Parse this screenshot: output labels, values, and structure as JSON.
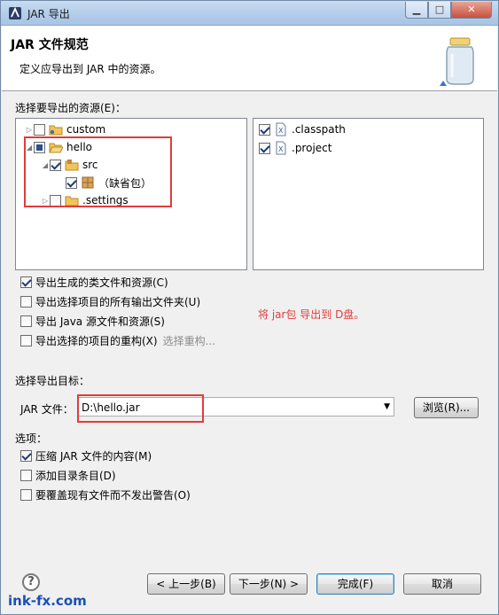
{
  "window": {
    "title": "JAR 导出"
  },
  "header": {
    "title": "JAR 文件规范",
    "description": "定义应导出到 JAR 中的资源。"
  },
  "resources": {
    "label": "选择要导出的资源(E)：",
    "tree": [
      {
        "label": "custom",
        "state": "unchecked"
      },
      {
        "label": "hello",
        "state": "partial"
      },
      {
        "label": "src",
        "state": "checked"
      },
      {
        "label": "（缺省包）",
        "state": "checked"
      },
      {
        "label": ".settings",
        "state": "unchecked"
      }
    ],
    "files": [
      {
        "label": ".classpath",
        "state": "checked"
      },
      {
        "label": ".project",
        "state": "checked"
      }
    ]
  },
  "options_top": {
    "export_classes": {
      "label": "导出生成的类文件和资源(C)",
      "checked": true
    },
    "export_output_folders": {
      "label": "导出选择项目的所有输出文件夹(U)",
      "checked": false
    },
    "export_java_source": {
      "label": "导出 Java 源文件和资源(S)",
      "checked": false
    },
    "export_refactorings": {
      "label": "导出选择的项目的重构(X)",
      "checked": false,
      "link": "选择重构..."
    }
  },
  "annotation": "将 jar包 导出到 D盘。",
  "destination": {
    "label": "选择导出目标：",
    "jar_file_label": "JAR 文件：",
    "jar_file_value": "D:\\hello.jar",
    "browse_label": "浏览(R)..."
  },
  "options": {
    "label": "选项：",
    "compress": {
      "label": "压缩 JAR 文件的内容(M)",
      "checked": true
    },
    "add_dirs": {
      "label": "添加目录条目(D)",
      "checked": false
    },
    "overwrite": {
      "label": "要覆盖现有文件而不发出警告(O)",
      "checked": false
    }
  },
  "buttons": {
    "back": "< 上一步(B)",
    "next": "下一步(N) >",
    "finish": "完成(F)",
    "cancel": "取消"
  },
  "watermark": "ink-fx.com"
}
